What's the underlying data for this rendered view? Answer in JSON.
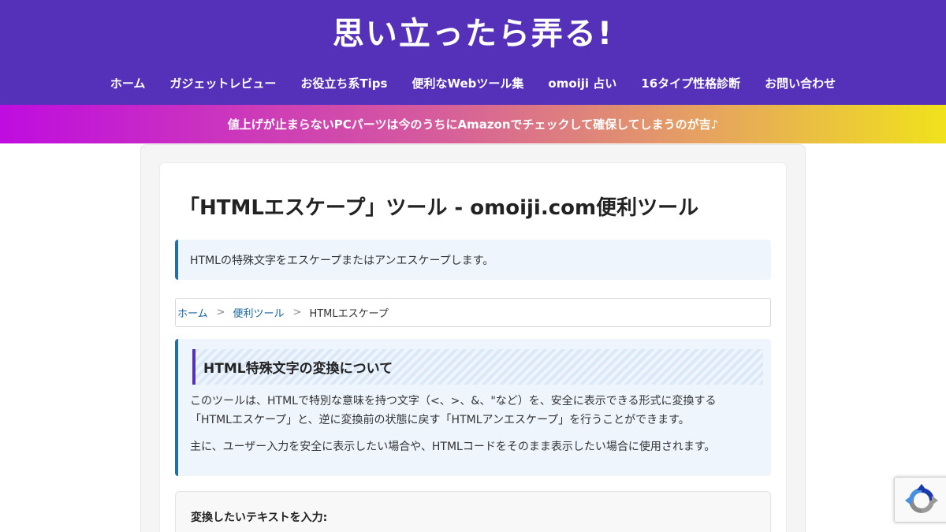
{
  "site": {
    "title": "思い立ったら弄る!"
  },
  "nav": {
    "items": [
      {
        "label": "ホーム"
      },
      {
        "label": "ガジェットレビュー"
      },
      {
        "label": "お役立ち系Tips"
      },
      {
        "label": "便利なWebツール集"
      },
      {
        "label": "omoiji 占い"
      },
      {
        "label": "16タイプ性格診断"
      },
      {
        "label": "お問い合わせ"
      }
    ]
  },
  "notice": {
    "text": "値上げが止まらないPCパーツは今のうちにAmazonでチェックして確保してしまうのが吉♪"
  },
  "page": {
    "title": "「HTMLエスケープ」ツール - omoiji.com便利ツール",
    "lead": "HTMLの特殊文字をエスケープまたはアンエスケープします。"
  },
  "breadcrumb": {
    "items": [
      {
        "label": "ホーム"
      },
      {
        "label": "便利ツール"
      },
      {
        "label": "HTMLエスケープ"
      }
    ],
    "separator": ">"
  },
  "about": {
    "heading": "HTML特殊文字の変換について",
    "paragraph1_line1": "このツールは、HTMLで特別な意味を持つ文字（<、>、&、\"など）を、安全に表示できる形式に変換する",
    "paragraph1_line2": "「HTMLエスケープ」と、逆に変換前の状態に戻す「HTMLアンエスケープ」を行うことができます。",
    "paragraph2": "主に、ユーザー入力を安全に表示したい場合や、HTMLコードをそのまま表示したい場合に使用されます。"
  },
  "input": {
    "label": "変換したいテキストを入力:"
  },
  "colors": {
    "header_bg": "#5530b9",
    "accent_blue": "#1f6fa8",
    "link": "#1566a4",
    "notice_gradient_start": "#bf0ce0",
    "notice_gradient_end": "#f0e21c"
  },
  "icons": {
    "recaptcha": "recaptcha-icon"
  }
}
